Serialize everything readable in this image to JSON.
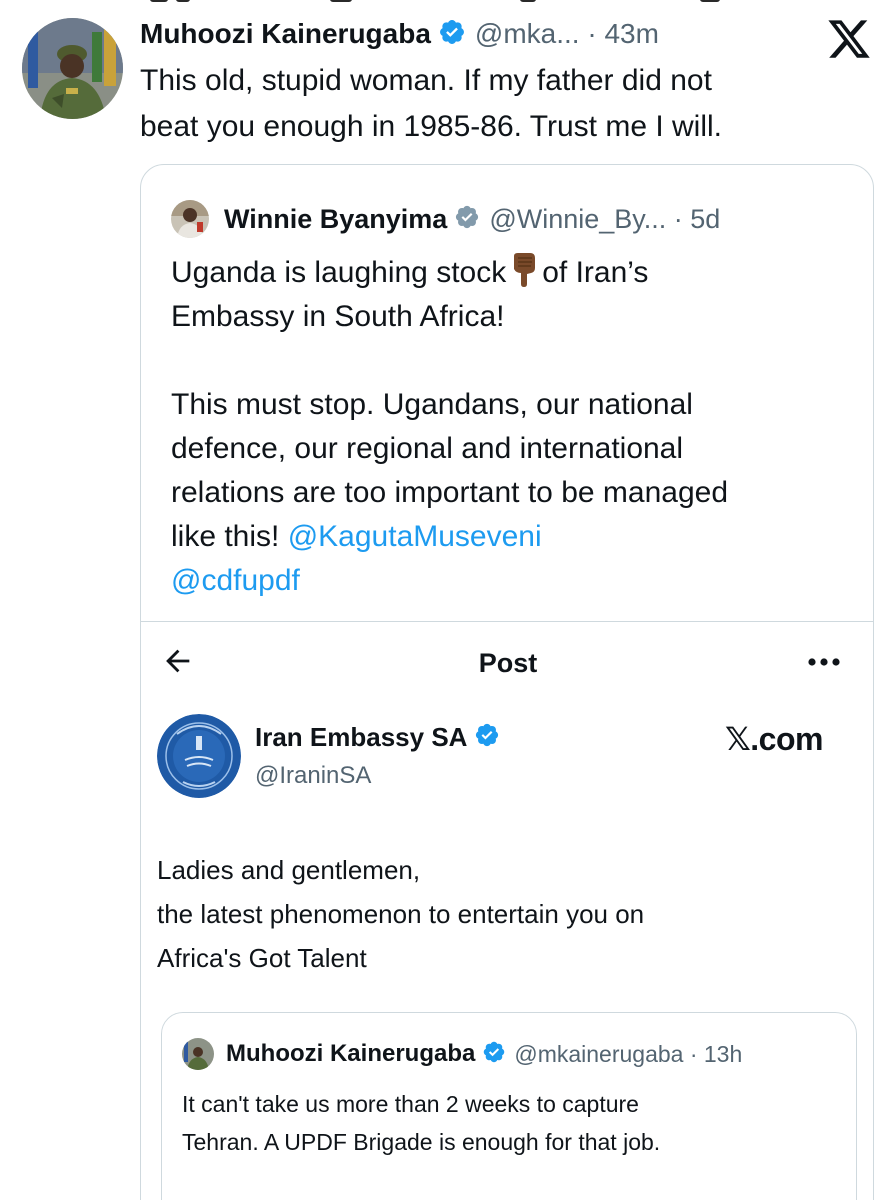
{
  "colors": {
    "text": "#0f1419",
    "secondary": "#536471",
    "link": "#1d9bf0",
    "border": "#cfd9de",
    "verified_blue": "#1d9bf0",
    "verified_gray": "#829aab"
  },
  "tweet": {
    "author_name": "Muhoozi Kainerugaba",
    "handle_time": "@mka... · 43m",
    "verified_icon": "verified-badge-blue",
    "text_lines": [
      "This old, stupid woman. If my father did not",
      "beat you enough in 1985-86. Trust me I will."
    ],
    "close_icon": "x-logo-icon"
  },
  "quote": {
    "author_name": "Winnie Byanyima",
    "handle_time": "@Winnie_By... · 5d",
    "verified_icon": "verified-badge-gray",
    "line1_a": "Uganda is laughing stock",
    "line1_emoji": "backhand-index-pointing-down",
    "line1_b": "of Iran’s",
    "line2": "Embassy in South Africa!",
    "para2_lines": [
      "This must stop. Ugandans, our national",
      "defence, our regional and international",
      "relations are too important to be managed"
    ],
    "line_last": "like this!",
    "mention1": "@KagutaMuseveni",
    "mention2": "@cdfupdf"
  },
  "embed": {
    "title": "Post",
    "back_icon": "arrow-left-icon",
    "more_icon": "more-dots-icon",
    "author_name": "Iran Embassy SA",
    "handle": "@IraninSA",
    "verified_icon": "verified-badge-blue",
    "brand": "𝕏.com",
    "text_lines": [
      "Ladies and gentlemen,",
      "the latest phenomenon to entertain you on",
      "Africa's Got Talent"
    ],
    "inner": {
      "author_name": "Muhoozi Kainerugaba",
      "handle_time": "@mkainerugaba · 13h",
      "verified_icon": "verified-badge-blue",
      "text_lines": [
        "It can't take us more than 2 weeks to capture",
        "Tehran. A UPDF Brigade is enough for that job."
      ]
    }
  }
}
